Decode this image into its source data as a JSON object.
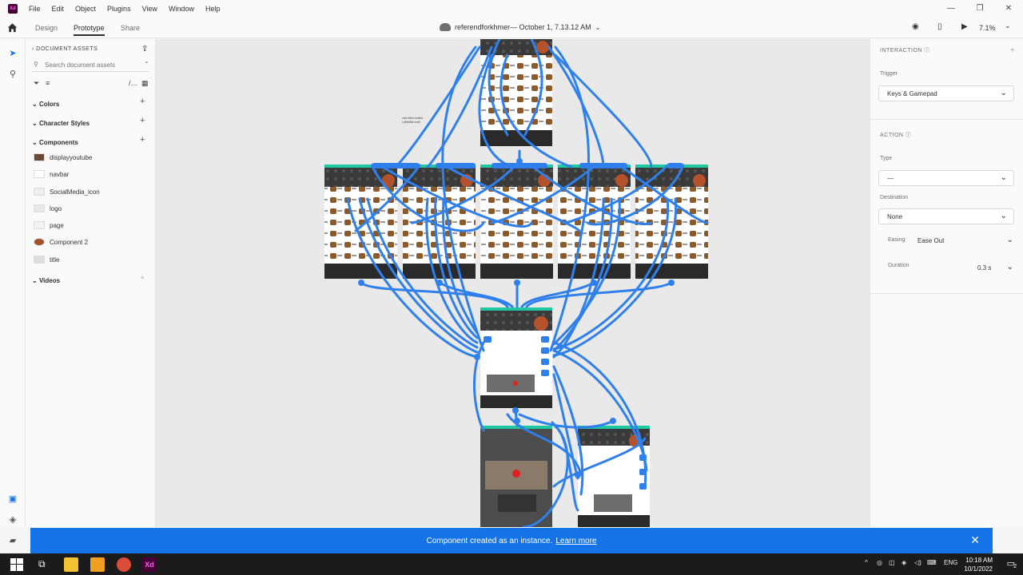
{
  "menubar": {
    "app_icon": "Xd",
    "items": [
      "File",
      "Edit",
      "Object",
      "Plugins",
      "View",
      "Window",
      "Help"
    ],
    "window_controls": [
      "—",
      "❐",
      "✕"
    ]
  },
  "toolbar": {
    "tabs": [
      "Design",
      "Prototype",
      "Share"
    ],
    "active_tab": "Prototype",
    "document_title": "referendforkhmer— October 1, 7.13.12 AM",
    "zoom": "7.1%"
  },
  "assets": {
    "header": "DOCUMENT ASSETS",
    "search_placeholder": "Search document assets",
    "sections": {
      "colors": "Colors",
      "character_styles": "Character Styles",
      "components": "Components",
      "videos": "Videos"
    },
    "components": [
      "displayyoutube",
      "navbar",
      "SocialMedia_icon",
      "logo",
      "page",
      "Component 2",
      "title"
    ]
  },
  "canvas": {
    "note_text": [
      "cfbd fdbd reddfdl",
      "Ldfdfdffdl nsdll"
    ]
  },
  "right_panel": {
    "interaction_header": "INTERACTION",
    "trigger_label": "Trigger",
    "trigger_value": "Keys & Gamepad",
    "action_header": "ACTION",
    "type_label": "Type",
    "type_value": "—",
    "destination_label": "Destination",
    "destination_value": "None",
    "easing_label": "Easing",
    "easing_value": "Ease Out",
    "duration_label": "Duration",
    "duration_value": "0.3 s"
  },
  "toast": {
    "message": "Component created as an instance.",
    "link": "Learn more"
  },
  "taskbar": {
    "language": "ENG",
    "time": "10:18 AM",
    "date": "10/1/2022",
    "notification_count": "2"
  },
  "colors": {
    "accent": "#1473e6",
    "wire": "#2f80ed",
    "artboard_header": "#1fc8a0"
  }
}
